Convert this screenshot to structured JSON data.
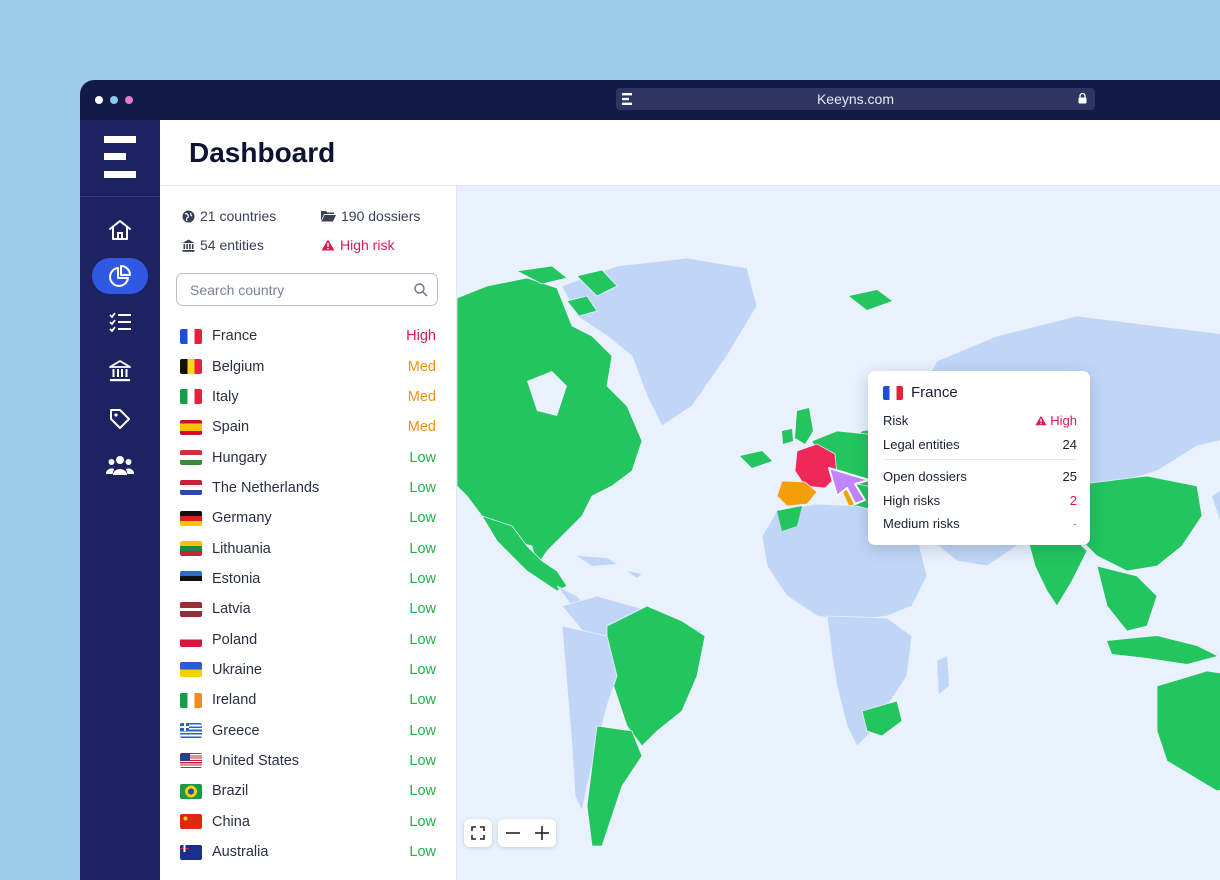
{
  "browser": {
    "url": "Keeyns.com"
  },
  "page": {
    "title": "Dashboard"
  },
  "stats": {
    "countries": "21 countries",
    "dossiers": "190 dossiers",
    "entities": "54 entities",
    "high_risk": "High risk"
  },
  "search": {
    "placeholder": "Search country"
  },
  "countries": [
    {
      "name": "France",
      "level": "High"
    },
    {
      "name": "Belgium",
      "level": "Med"
    },
    {
      "name": "Italy",
      "level": "Med"
    },
    {
      "name": "Spain",
      "level": "Med"
    },
    {
      "name": "Hungary",
      "level": "Low"
    },
    {
      "name": "The Netherlands",
      "level": "Low"
    },
    {
      "name": "Germany",
      "level": "Low"
    },
    {
      "name": "Lithuania",
      "level": "Low"
    },
    {
      "name": "Estonia",
      "level": "Low"
    },
    {
      "name": "Latvia",
      "level": "Low"
    },
    {
      "name": "Poland",
      "level": "Low"
    },
    {
      "name": "Ukraine",
      "level": "Low"
    },
    {
      "name": "Ireland",
      "level": "Low"
    },
    {
      "name": "Greece",
      "level": "Low"
    },
    {
      "name": "United States",
      "level": "Low"
    },
    {
      "name": "Brazil",
      "level": "Low"
    },
    {
      "name": "China",
      "level": "Low"
    },
    {
      "name": "Australia",
      "level": "Low"
    }
  ],
  "tooltip": {
    "country": "France",
    "risk_label": "Risk",
    "risk_value": "High",
    "legal_entities_label": "Legal entities",
    "legal_entities_value": "24",
    "open_dossiers_label": "Open dossiers",
    "open_dossiers_value": "25",
    "high_risks_label": "High risks",
    "high_risks_value": "2",
    "medium_risks_label": "Medium risks",
    "medium_risks_value": "-"
  },
  "colors": {
    "high": "#e0184f",
    "med": "#f2900f",
    "low": "#21b24b",
    "map_green": "#22c55e",
    "map_blue": "#c1d6f7",
    "accent": "#2f59e2"
  },
  "nav_icons": [
    "home-icon",
    "chart-pie-icon",
    "checklist-icon",
    "bank-icon",
    "tag-icon",
    "users-icon"
  ]
}
